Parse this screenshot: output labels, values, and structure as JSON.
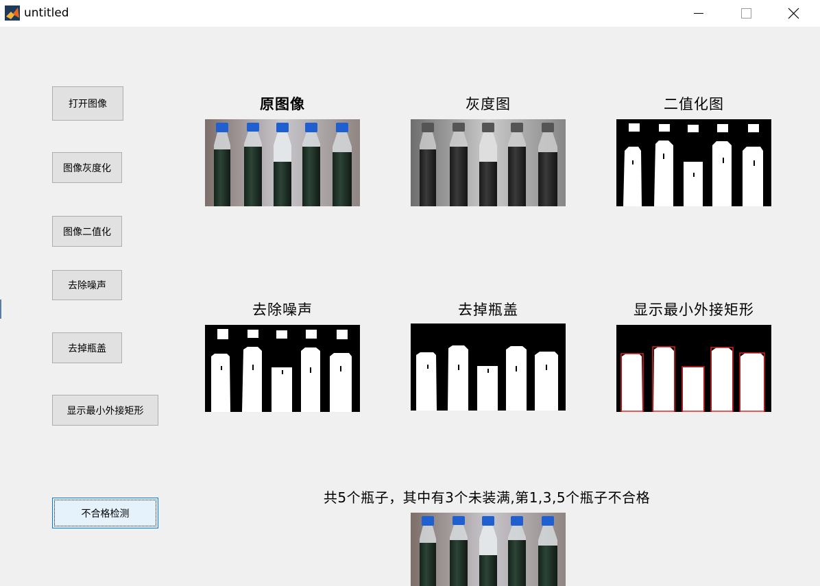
{
  "window": {
    "title": "untitled",
    "controls": [
      "minimize",
      "maximize",
      "close"
    ]
  },
  "buttons": {
    "open_image": "打开图像",
    "grayscale": "图像灰度化",
    "binarize": "图像二值化",
    "denoise": "去除噪声",
    "remove_cap": "去掉瓶盖",
    "show_bbox": "显示最小外接矩形",
    "defect_detect": "不合格检测"
  },
  "panels": {
    "original": "原图像",
    "gray": "灰度图",
    "binary": "二值化图",
    "denoised": "去除噪声",
    "capless": "去掉瓶盖",
    "bbox": "显示最小外接矩形"
  },
  "result": {
    "text": "共5个瓶子，其中有3个未装满,第1,3,5个瓶子不合格"
  },
  "colors": {
    "background": "#f0f0f0",
    "bottle_cap": "#1f5fd0",
    "bbox_line": "#e02020"
  }
}
